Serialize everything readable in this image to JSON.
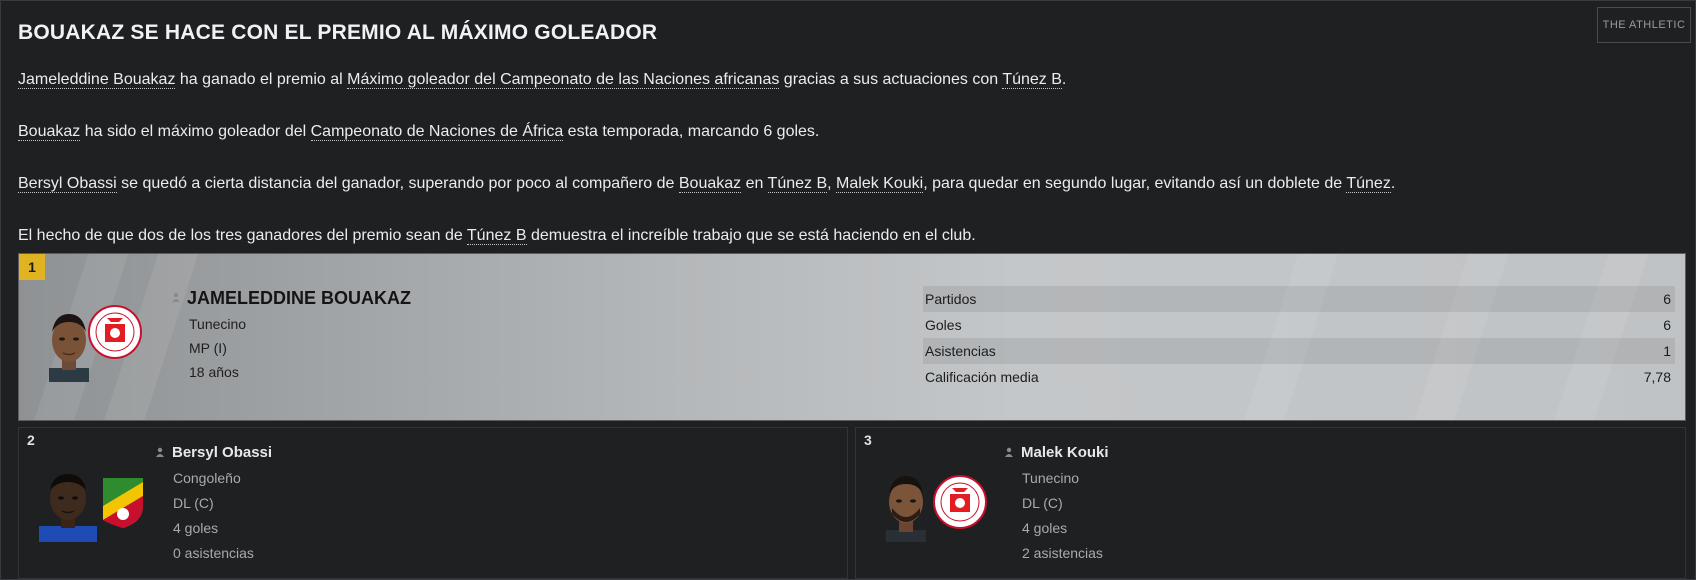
{
  "article": {
    "headline": "BOUAKAZ SE HACE CON EL PREMIO AL MÁXIMO GOLEADOR",
    "source": "THE ATHLETIC",
    "p1": {
      "a": "Jameleddine Bouakaz",
      "b": " ha ganado el premio al ",
      "c": "Máximo goleador del Campeonato de las Naciones africanas",
      "d": " gracias a sus actuaciones con ",
      "e": "Túnez B",
      "f": "."
    },
    "p2": {
      "a": "Bouakaz",
      "b": " ha sido el máximo goleador del ",
      "c": "Campeonato de Naciones de África",
      "d": " esta temporada, marcando 6 goles."
    },
    "p3": {
      "a": "Bersyl Obassi",
      "b": " se quedó a cierta distancia del ganador, superando por poco al compañero de ",
      "c": "Bouakaz",
      "d": " en ",
      "e": "Túnez B",
      "f": ", ",
      "g": "Malek Kouki",
      "h": ", para quedar en segundo lugar, evitando así un doblete de ",
      "i": "Túnez",
      "j": "."
    },
    "p4": {
      "a": "El hecho de que dos de los tres ganadores del premio sean de ",
      "b": "Túnez B",
      "c": " demuestra el increíble trabajo que se está haciendo en el club."
    }
  },
  "winner": {
    "rank": "1",
    "name": "JAMELEDDINE BOUAKAZ",
    "nationality": "Tunecino",
    "position": "MP (I)",
    "age": "18 años",
    "stats": [
      {
        "label": "Partidos",
        "value": "6"
      },
      {
        "label": "Goles",
        "value": "6"
      },
      {
        "label": "Asistencias",
        "value": "1"
      },
      {
        "label": "Calificación media",
        "value": "7,78"
      }
    ]
  },
  "runners_up": [
    {
      "rank": "2",
      "name": "Bersyl Obassi",
      "nationality": "Congoleño",
      "position": "DL (C)",
      "goals": "4 goles",
      "assists": "0 asistencias"
    },
    {
      "rank": "3",
      "name": "Malek Kouki",
      "nationality": "Tunecino",
      "position": "DL (C)",
      "goals": "4 goles",
      "assists": "2 asistencias"
    }
  ],
  "colors": {
    "gold": "#e0b323",
    "background": "#1f2022",
    "winner_band": "#c0c3c5"
  },
  "icons": [
    "person-icon",
    "tunisia-federation-badge",
    "congo-federation-badge",
    "player-face"
  ]
}
